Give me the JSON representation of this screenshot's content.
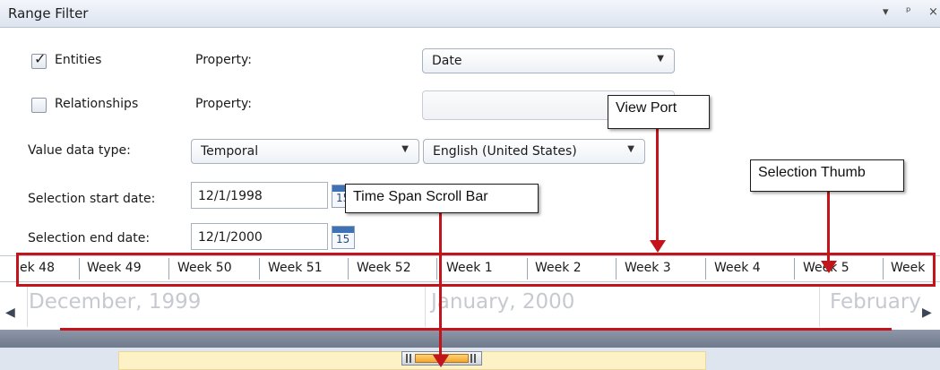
{
  "titlebar": {
    "title": "Range Filter",
    "dropdown_icon": "▾",
    "pin_icon": "ᵖ",
    "close_icon": "×"
  },
  "entities": {
    "label": "Entities",
    "checked": true,
    "property_label": "Property:",
    "property_value": "Date"
  },
  "relationships": {
    "label": "Relationships",
    "checked": false,
    "property_label": "Property:",
    "property_value": ""
  },
  "value_type": {
    "label": "Value data type:",
    "value": "Temporal",
    "culture": "English (United States)"
  },
  "selection": {
    "start_label": "Selection start date:",
    "start_value": "12/1/1998",
    "end_label": "Selection end date:",
    "end_value": "12/1/2000",
    "calendar_day": "15"
  },
  "timeline": {
    "weeks": [
      "ek 48",
      "Week 49",
      "Week 50",
      "Week 51",
      "Week 52",
      "Week 1",
      "Week 2",
      "Week 3",
      "Week 4",
      "Week 5",
      "Week"
    ],
    "months": [
      "December, 1999",
      "January, 2000",
      "February"
    ]
  },
  "callouts": {
    "view_port": "View Port",
    "selection_thumb": "Selection Thumb",
    "time_span_scroll_bar": "Time Span Scroll Bar"
  },
  "colors": {
    "annotation_red": "#c4141b",
    "scroll_track": "#fdf1c6"
  }
}
